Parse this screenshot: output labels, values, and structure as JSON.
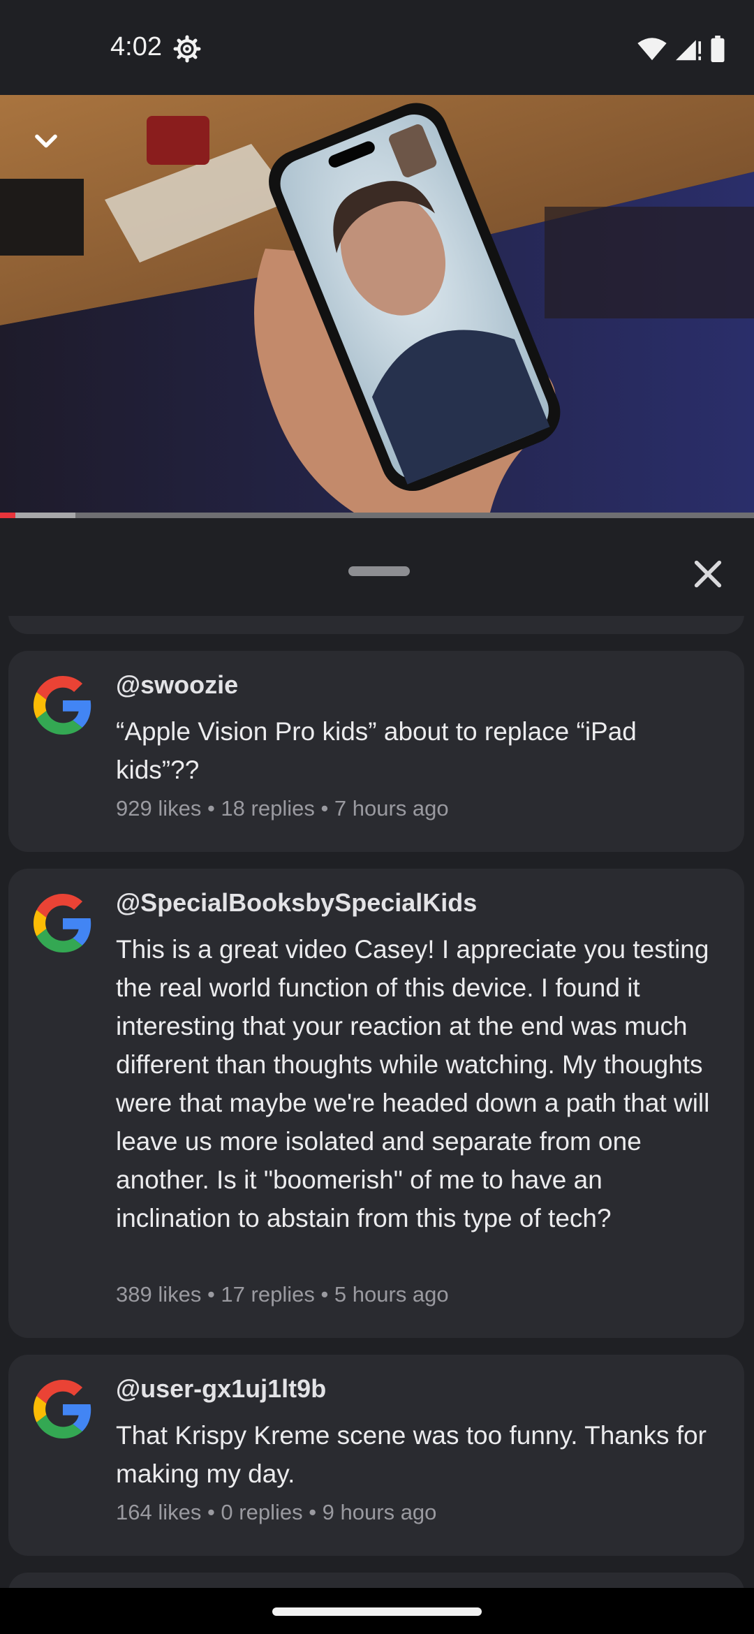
{
  "status_bar": {
    "time": "4:02",
    "icons": [
      "gear-icon",
      "wifi-icon",
      "signal-icon",
      "battery-icon"
    ]
  },
  "player": {
    "collapse_icon": "chevron-down-icon",
    "progress_played_fraction": 0.02,
    "progress_buffered_fraction": 0.1,
    "progress_color": "#e8343b"
  },
  "sheet": {
    "close_icon": "close-icon",
    "handle_icon": "drag-handle"
  },
  "comments": [
    {
      "author": "@swoozie",
      "text": "“Apple Vision Pro kids” about to replace “iPad kids”??",
      "meta": "929 likes • 18 replies • 7 hours ago",
      "avatar": "google-logo-icon"
    },
    {
      "author": "@SpecialBooksbySpecialKids",
      "text": "This is a great video Casey! I appreciate you testing the real world function of this device. I found it interesting that your reaction at the end was much different than thoughts while watching. My thoughts were that maybe we're headed down a path that will leave us more isolated and separate from one another. Is it \"boomerish\" of me to have an inclination to abstain from this type of tech?",
      "meta": "389 likes • 17 replies • 5 hours ago",
      "avatar": "google-logo-icon"
    },
    {
      "author": "@user-gx1uj1lt9b",
      "text": "That Krispy Kreme scene was too funny. Thanks for making my day.",
      "meta": "164 likes • 0 replies • 9 hours ago",
      "avatar": "google-logo-icon"
    }
  ],
  "colors": {
    "background": "#1f2024",
    "card": "#2a2b30",
    "meta_text": "#9a9aa0"
  }
}
